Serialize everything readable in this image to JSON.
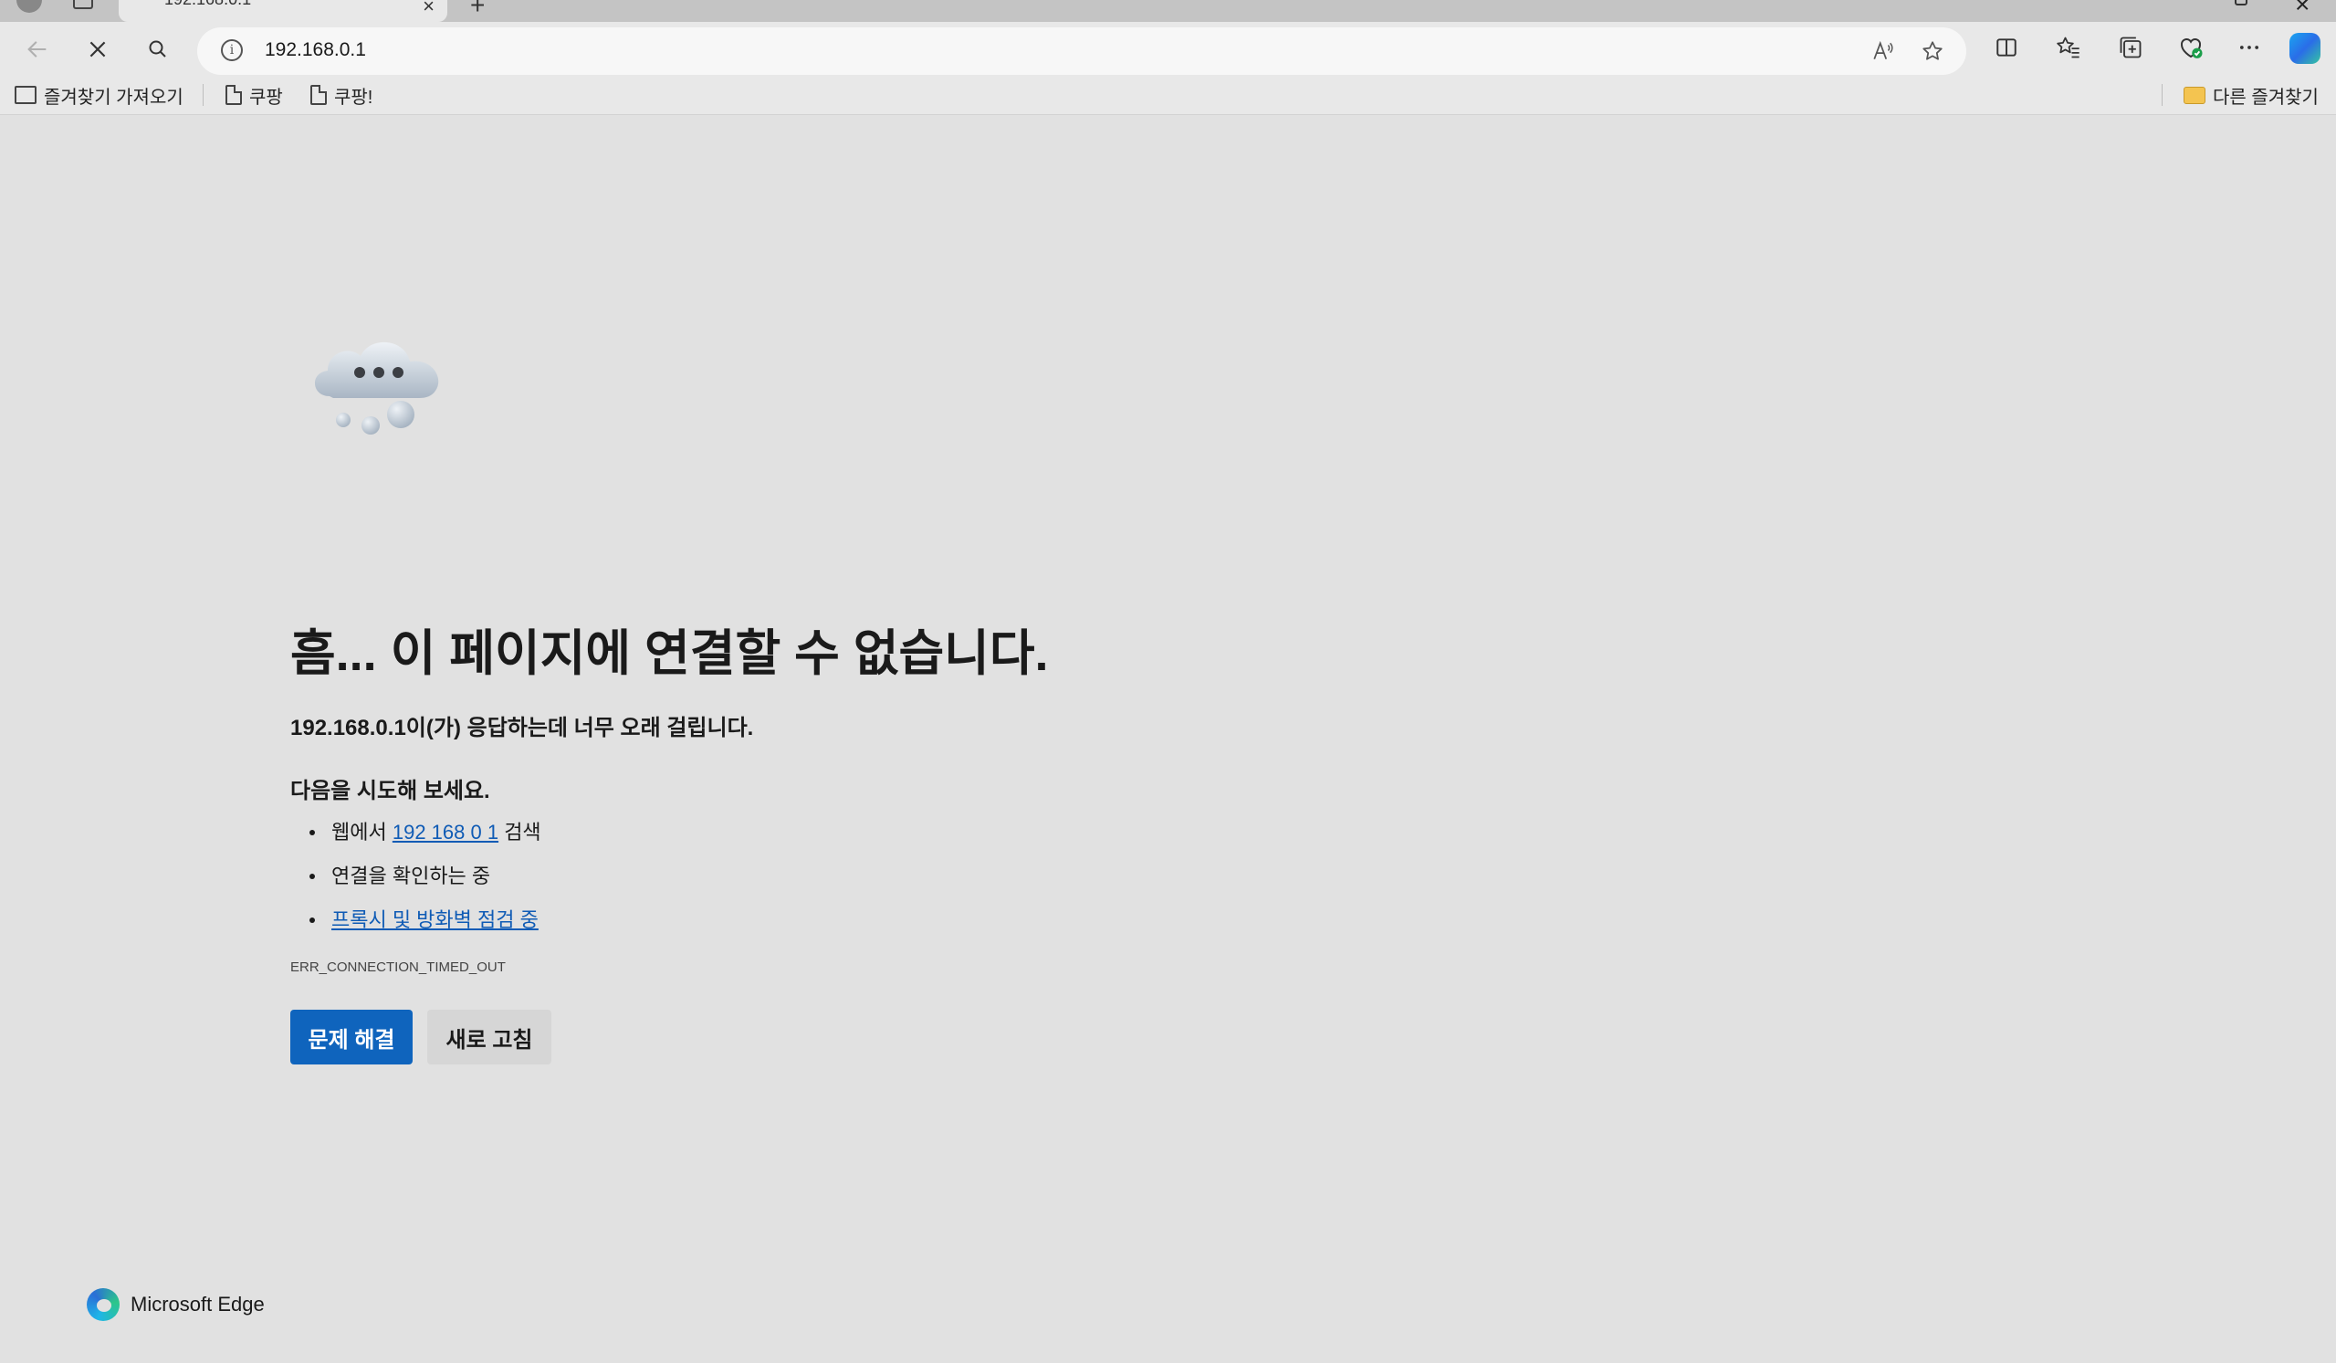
{
  "tab": {
    "title": "192.168.0.1",
    "close_glyph": "×",
    "new_tab_glyph": "+"
  },
  "window": {
    "close_glyph": "×"
  },
  "address": {
    "url": "192.168.0.1",
    "info_glyph": "i"
  },
  "favorites": {
    "items": [
      {
        "label": "즐겨찾기 가져오기",
        "icon": "import-icon"
      },
      {
        "label": "쿠팡",
        "icon": "page-icon"
      },
      {
        "label": "쿠팡!",
        "icon": "page-icon"
      }
    ],
    "other": {
      "label": "다른 즐겨찾기",
      "icon": "folder-icon"
    }
  },
  "error": {
    "headline": "흠... 이 페이지에 연결할 수 없습니다.",
    "host": "192.168.0.1",
    "subline_rest": "이(가) 응답하는데 너무 오래 걸립니다.",
    "try_heading": "다음을 시도해 보세요.",
    "suggestions": {
      "search_prefix": "웹에서 ",
      "search_link": "192 168 0 1",
      "search_suffix": " 검색",
      "check_connection": "연결을 확인하는 중",
      "proxy_link": "프록시 및 방화벽 점검 중"
    },
    "code": "ERR_CONNECTION_TIMED_OUT",
    "troubleshoot_button": "문제 해결",
    "refresh_button": "새로 고침"
  },
  "brand": {
    "name": "Microsoft Edge"
  },
  "colors": {
    "primary_button": "#0f64bd",
    "link": "#0f5bb5",
    "page_background": "#e1e1e1"
  }
}
